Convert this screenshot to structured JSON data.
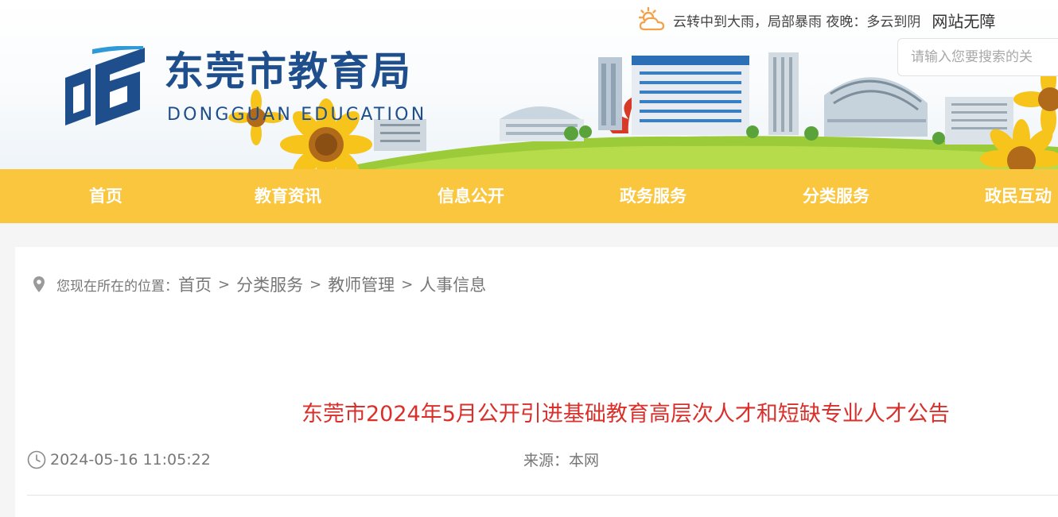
{
  "header": {
    "logo_cn": "东莞市教育局",
    "logo_en": "DONGGUAN EDUCATION",
    "weather_text": "云转中到大雨，局部暴雨 夜晚：多云到阴",
    "weather_icon": "partly-cloudy-sun-icon",
    "accessible_link": "网站无障",
    "search_placeholder": "请输入您要搜索的关",
    "colors": {
      "brand_blue": "#1f4e8c",
      "nav_yellow": "#f9c63e"
    }
  },
  "nav": {
    "items": [
      {
        "label": "首页"
      },
      {
        "label": "教育资讯"
      },
      {
        "label": "信息公开"
      },
      {
        "label": "政务服务"
      },
      {
        "label": "分类服务"
      },
      {
        "label": "政民互动"
      }
    ]
  },
  "breadcrumb": {
    "prefix": "您现在所在的位置：",
    "items": [
      "首页",
      "分类服务",
      "教师管理",
      "人事信息"
    ],
    "separator": ">",
    "icon": "location-pin-icon"
  },
  "article": {
    "title": "东莞市2024年5月公开引进基础教育高层次人才和短缺专业人才公告",
    "date": "2024-05-16 11:05:22",
    "source": "来源：本网",
    "title_color": "#d9302c"
  }
}
